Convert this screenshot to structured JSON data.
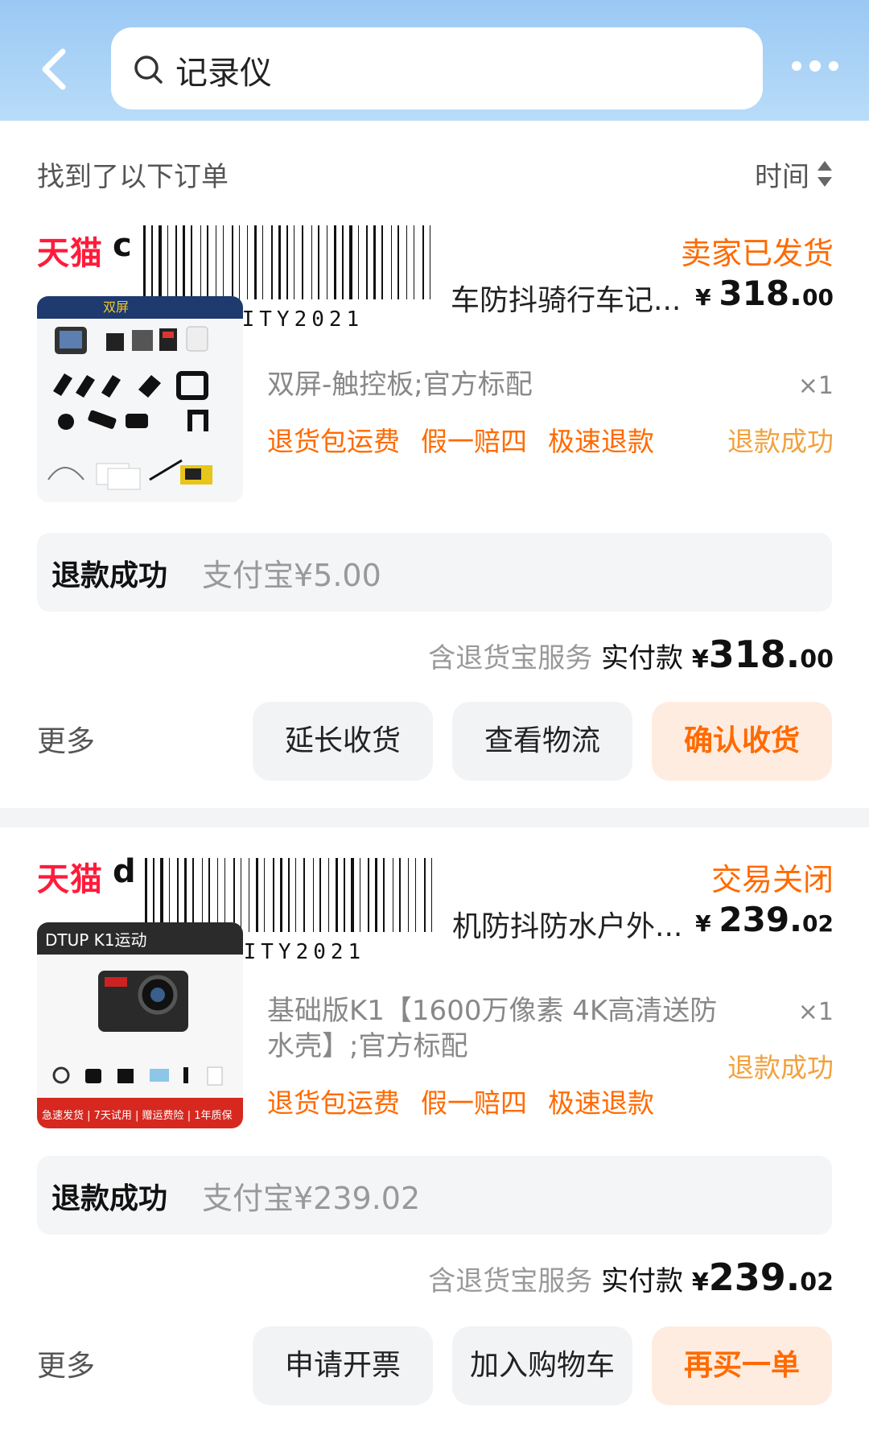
{
  "header": {
    "back_icon": "chevron-left-icon",
    "search_query": "记录仪",
    "more_icon": "more-dots-icon"
  },
  "list": {
    "found_text": "找到了以下订单",
    "sort_label": "时间"
  },
  "orders": [
    {
      "shop_logo": "天猫",
      "shop_initial": "c",
      "barcode_text": "REDCITY2021",
      "status": "卖家已发货",
      "title": "车防抖骑行车记...",
      "price_symbol": "¥",
      "price_int": "318.",
      "price_dec": "00",
      "spec": "双屏-触控板;官方标配",
      "qty": "×1",
      "tags": [
        "退货包运费",
        "假一赔四",
        "极速退款"
      ],
      "item_status": "退款成功",
      "refund_label": "退款成功",
      "refund_detail": "支付宝¥5.00",
      "service_text": "含退货宝服务",
      "paid_label": "实付款",
      "paid_symbol": "¥",
      "paid_int": "318.",
      "paid_dec": "00",
      "more": "更多",
      "buttons": [
        "延长收货",
        "查看物流",
        "确认收货"
      ],
      "thumb_label": "双屏"
    },
    {
      "shop_logo": "天猫",
      "shop_initial": "d",
      "barcode_text": "REDCITY2021",
      "status": "交易关闭",
      "title": "机防抖防水户外...",
      "price_symbol": "¥",
      "price_int": "239.",
      "price_dec": "02",
      "spec": "基础版K1【1600万像素 4K高清送防水壳】;官方标配",
      "qty": "×1",
      "tags": [
        "退货包运费",
        "假一赔四",
        "极速退款"
      ],
      "item_status": "退款成功",
      "refund_label": "退款成功",
      "refund_detail": "支付宝¥239.02",
      "service_text": "含退货宝服务",
      "paid_label": "实付款",
      "paid_symbol": "¥",
      "paid_int": "239.",
      "paid_dec": "02",
      "more": "更多",
      "buttons": [
        "申请开票",
        "加入购物车",
        "再买一单"
      ],
      "thumb_label": "DTUP K1运动",
      "thumb_banner": "急速发货 | 7天试用 | 赠运费险 | 1年质保"
    }
  ],
  "colors": {
    "accent_orange": "#ff6a00",
    "tmall_red": "#ff1b3b",
    "header_blue": "#9ac8f4"
  }
}
